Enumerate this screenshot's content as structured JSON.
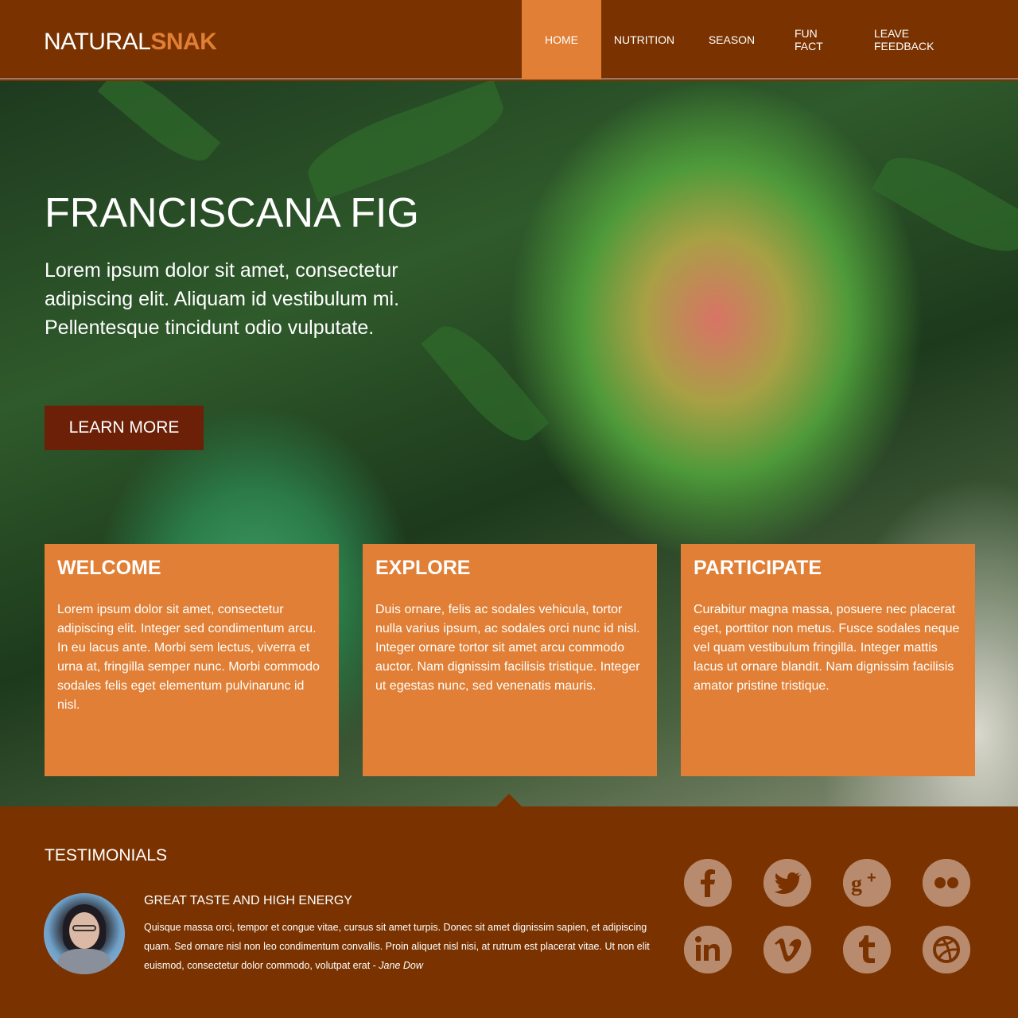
{
  "header": {
    "logo_part1": "NATURAL",
    "logo_part2": "SNAK",
    "nav": [
      "HOME",
      "NUTRITION",
      "SEASON",
      "FUN FACT",
      "LEAVE FEEDBACK"
    ],
    "active_nav": "HOME"
  },
  "hero": {
    "title": "FRANCISCANA FIG",
    "text": "Lorem ipsum dolor sit amet, consectetur adipiscing elit. Aliquam id vestibulum mi. Pellentesque tincidunt odio vulputate.",
    "button": "LEARN MORE"
  },
  "cards": [
    {
      "title": "WELCOME",
      "text": "Lorem ipsum dolor sit amet, consectetur adipiscing elit. Integer sed condimentum arcu. In eu lacus ante. Morbi sem lectus, viverra et urna at, fringilla semper nunc. Morbi commodo sodales felis eget elementum pulvinarunc id nisl."
    },
    {
      "title": "EXPLORE",
      "text": "Duis ornare, felis ac sodales vehicula, tortor nulla varius ipsum, ac sodales orci nunc id nisl. Integer ornare tortor sit amet arcu commodo auctor. Nam dignissim facilisis tristique. Integer ut egestas nunc, sed venenatis mauris."
    },
    {
      "title": "PARTICIPATE",
      "text": "Curabitur magna massa, posuere nec placerat eget, porttitor non metus. Fusce sodales neque vel quam vestibulum fringilla. Integer mattis lacus ut ornare blandit. Nam dignissim facilisis amator pristine tristique."
    }
  ],
  "testimonials": {
    "heading": "TESTIMONIALS",
    "quote_title": "GREAT TASTE AND HIGH ENERGY",
    "quote_text": "Quisque massa orci, tempor et congue vitae, cursus sit amet turpis. Donec sit amet dignissim sapien, et adipiscing quam. Sed ornare nisl non leo condimentum convallis. Proin aliquet nisl nisi, at rutrum est placerat vitae. Ut non elit euismod, consectetur dolor commodo, volutpat erat - ",
    "author": "Jane Dow"
  },
  "social_icons": [
    "facebook-icon",
    "twitter-icon",
    "google-plus-icon",
    "flickr-icon",
    "linkedin-icon",
    "vimeo-icon",
    "tumblr-icon",
    "dribbble-icon"
  ],
  "colors": {
    "brown": "#7a3300",
    "orange": "#e07f35",
    "dark_button": "#6d2008",
    "social": "#b88a6e"
  }
}
